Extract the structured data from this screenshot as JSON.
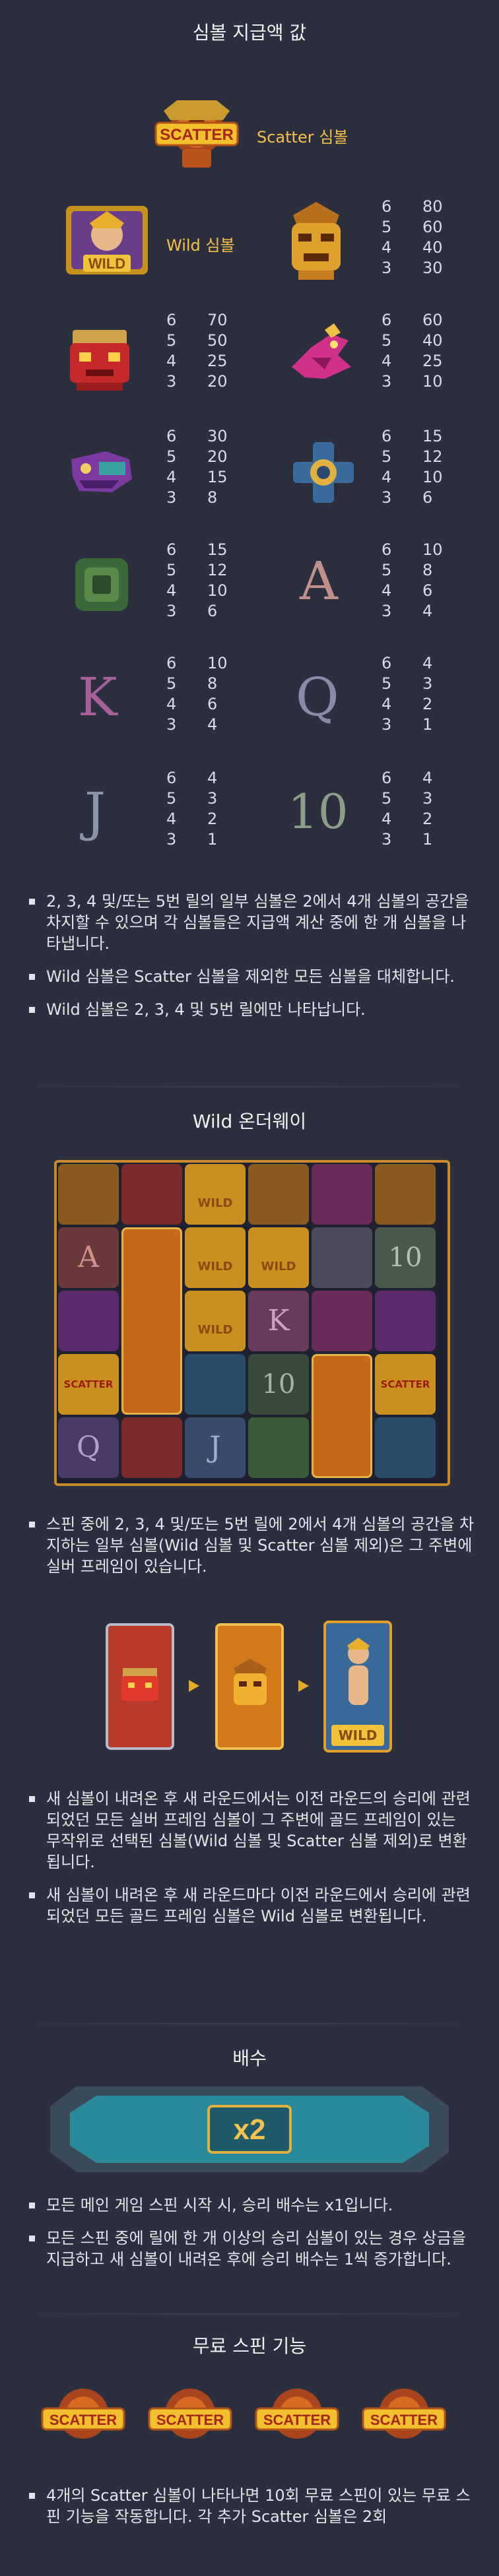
{
  "paytable": {
    "title": "심볼 지급액 값",
    "scatter_label": "Scatter 심볼",
    "wild_label": "Wild 심볼",
    "scatter_text": "SCATTER",
    "wild_text": "WILD",
    "symbols": [
      {
        "name": "gold-mask",
        "pays": [
          [
            "6",
            "80"
          ],
          [
            "5",
            "60"
          ],
          [
            "4",
            "40"
          ],
          [
            "3",
            "30"
          ]
        ]
      },
      {
        "name": "red-totem",
        "pays": [
          [
            "6",
            "70"
          ],
          [
            "5",
            "50"
          ],
          [
            "4",
            "25"
          ],
          [
            "3",
            "20"
          ]
        ]
      },
      {
        "name": "pink-bird",
        "pays": [
          [
            "6",
            "60"
          ],
          [
            "5",
            "40"
          ],
          [
            "4",
            "25"
          ],
          [
            "3",
            "10"
          ]
        ]
      },
      {
        "name": "purple-serpent",
        "pays": [
          [
            "6",
            "30"
          ],
          [
            "5",
            "20"
          ],
          [
            "4",
            "15"
          ],
          [
            "3",
            "8"
          ]
        ]
      },
      {
        "name": "blue-cross",
        "pays": [
          [
            "6",
            "15"
          ],
          [
            "5",
            "12"
          ],
          [
            "4",
            "10"
          ],
          [
            "3",
            "6"
          ]
        ]
      },
      {
        "name": "green-glyph",
        "pays": [
          [
            "6",
            "15"
          ],
          [
            "5",
            "12"
          ],
          [
            "4",
            "10"
          ],
          [
            "3",
            "6"
          ]
        ]
      },
      {
        "name": "A",
        "pays": [
          [
            "6",
            "10"
          ],
          [
            "5",
            "8"
          ],
          [
            "4",
            "6"
          ],
          [
            "3",
            "4"
          ]
        ]
      },
      {
        "name": "K",
        "pays": [
          [
            "6",
            "10"
          ],
          [
            "5",
            "8"
          ],
          [
            "4",
            "6"
          ],
          [
            "3",
            "4"
          ]
        ]
      },
      {
        "name": "Q",
        "pays": [
          [
            "6",
            "4"
          ],
          [
            "5",
            "3"
          ],
          [
            "4",
            "2"
          ],
          [
            "3",
            "1"
          ]
        ]
      },
      {
        "name": "J",
        "pays": [
          [
            "6",
            "4"
          ],
          [
            "5",
            "3"
          ],
          [
            "4",
            "2"
          ],
          [
            "3",
            "1"
          ]
        ]
      },
      {
        "name": "10",
        "pays": [
          [
            "6",
            "4"
          ],
          [
            "5",
            "3"
          ],
          [
            "4",
            "2"
          ],
          [
            "3",
            "1"
          ]
        ]
      }
    ],
    "bullets": [
      "2, 3, 4 및/또는 5번 릴의 일부 심볼은 2에서 4개 심볼의 공간을 차지할 수 있으며 각 심볼들은 지급액 계산 중에 한 개 심볼을 나타냅니다.",
      "Wild 심볼은 Scatter 심볼을 제외한 모든 심볼을 대체합니다.",
      "Wild 심볼은 2, 3, 4 및 5번 릴에만 나타납니다."
    ]
  },
  "wild_way": {
    "title": "Wild 온더웨이",
    "grid_letters": {
      "a": "A",
      "k": "K",
      "q": "Q",
      "j": "J",
      "ten": "10"
    },
    "bullets_top": [
      "스핀 중에 2, 3, 4 및/또는 5번 릴에 2에서 4개 심볼의 공간을 차지하는 일부 심볼(Wild 심볼 및 Scatter 심볼 제외)은 그 주변에 실버 프레임이 있습니다."
    ],
    "bullets_bottom": [
      "새 심볼이 내려온 후 새 라운드에서는 이전 라운드의 승리에 관련되었던 모든 실버 프레임 심볼이 그 주변에 골드 프레임이 있는 무작위로 선택된 심볼(Wild 심볼 및 Scatter 심볼 제외)로 변환됩니다.",
      "새 심볼이 내려온 후 새 라운드마다 이전 라운드에서 승리에 관련되었던 모든 골드 프레임 심볼은 Wild 심볼로 변환됩니다."
    ]
  },
  "multiplier": {
    "title": "배수",
    "banner_text": "x2",
    "bullets": [
      "모든 메인 게임 스핀 시작 시, 승리 배수는 x1입니다.",
      "모든 스핀 중에 릴에 한 개 이상의 승리 심볼이 있는 경우 상금을 지급하고 새 심볼이 내려온 후에 승리 배수는 1씩 증가합니다."
    ]
  },
  "free_spins": {
    "title": "무료 스핀 기능",
    "scatter_text": "SCATTER",
    "bullets": [
      "4개의 Scatter 심볼이 나타나면 10회 무료 스핀이 있는 무료 스핀 기능을 작동합니다. 각 추가 Scatter 심볼은 2회"
    ]
  },
  "colors": {
    "background": "#2c2f3d",
    "gold": "#f6c04c",
    "text": "#e6e6ea"
  }
}
